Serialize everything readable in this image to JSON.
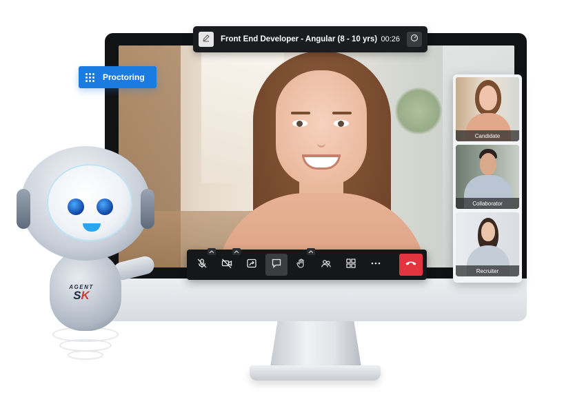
{
  "meeting": {
    "title": "Front End Developer - Angular (8 - 10 yrs)",
    "timer": "00:26"
  },
  "proctoring": {
    "label": "Proctoring"
  },
  "participants": [
    {
      "label": "Candidate",
      "active": true
    },
    {
      "label": "Collaborator",
      "active": false
    },
    {
      "label": "Recruiter",
      "active": false
    }
  ],
  "controls": [
    {
      "icon": "mic-off-icon",
      "has_caret": true
    },
    {
      "icon": "camera-off-icon",
      "has_caret": true
    },
    {
      "icon": "screen-share-icon",
      "has_caret": false
    },
    {
      "icon": "chat-icon",
      "has_caret": false,
      "selected": true
    },
    {
      "icon": "raise-hand-icon",
      "has_caret": true
    },
    {
      "icon": "participants-icon",
      "has_caret": false
    },
    {
      "icon": "grid-view-icon",
      "has_caret": false
    },
    {
      "icon": "more-icon",
      "has_caret": false
    },
    {
      "icon": "end-call-icon",
      "has_caret": false
    }
  ],
  "mascot": {
    "brand_top": "AGENT",
    "brand_main_1": "S",
    "brand_main_2": "K"
  },
  "colors": {
    "accent": "#1a7ce0",
    "end_call": "#e2343f",
    "toolbar": "#161719"
  }
}
